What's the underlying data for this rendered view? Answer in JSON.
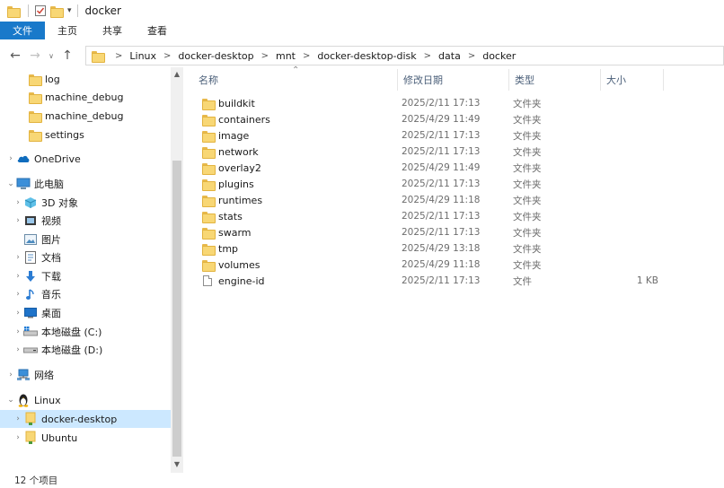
{
  "window": {
    "title": "docker"
  },
  "ribbon": {
    "tabs": [
      "文件",
      "主页",
      "共享",
      "查看"
    ]
  },
  "address": {
    "crumbs": [
      "Linux",
      "docker-desktop",
      "mnt",
      "docker-desktop-disk",
      "data",
      "docker"
    ]
  },
  "columns": {
    "name": "名称",
    "date": "修改日期",
    "type": "类型",
    "size": "大小"
  },
  "nav": {
    "quick_items": [
      "log",
      "machine_debug",
      "machine_debug",
      "settings"
    ],
    "onedrive": "OneDrive",
    "this_pc": "此电脑",
    "pc_items": [
      "3D 对象",
      "视频",
      "图片",
      "文档",
      "下载",
      "音乐",
      "桌面",
      "本地磁盘 (C:)",
      "本地磁盘 (D:)"
    ],
    "network": "网络",
    "linux": "Linux",
    "linux_items": [
      "docker-desktop",
      "Ubuntu"
    ]
  },
  "files": [
    {
      "name": "buildkit",
      "date": "2025/2/11 17:13",
      "type": "文件夹",
      "size": ""
    },
    {
      "name": "containers",
      "date": "2025/4/29 11:49",
      "type": "文件夹",
      "size": ""
    },
    {
      "name": "image",
      "date": "2025/2/11 17:13",
      "type": "文件夹",
      "size": ""
    },
    {
      "name": "network",
      "date": "2025/2/11 17:13",
      "type": "文件夹",
      "size": ""
    },
    {
      "name": "overlay2",
      "date": "2025/4/29 11:49",
      "type": "文件夹",
      "size": ""
    },
    {
      "name": "plugins",
      "date": "2025/2/11 17:13",
      "type": "文件夹",
      "size": ""
    },
    {
      "name": "runtimes",
      "date": "2025/4/29 11:18",
      "type": "文件夹",
      "size": ""
    },
    {
      "name": "stats",
      "date": "2025/2/11 17:13",
      "type": "文件夹",
      "size": ""
    },
    {
      "name": "swarm",
      "date": "2025/2/11 17:13",
      "type": "文件夹",
      "size": ""
    },
    {
      "name": "tmp",
      "date": "2025/4/29 13:18",
      "type": "文件夹",
      "size": ""
    },
    {
      "name": "volumes",
      "date": "2025/4/29 11:18",
      "type": "文件夹",
      "size": ""
    },
    {
      "name": "engine-id",
      "date": "2025/2/11 17:13",
      "type": "文件",
      "size": "1 KB"
    }
  ],
  "status": {
    "count": "12 个项目"
  },
  "colors": {
    "file_tab": "#1979ca",
    "selection": "#cce8ff",
    "folder": "#f8d775"
  }
}
